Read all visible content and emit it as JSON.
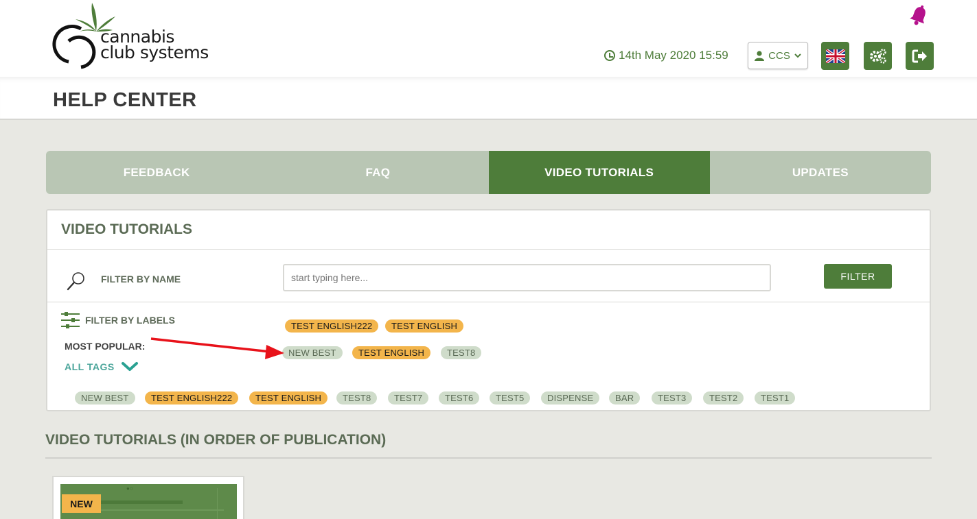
{
  "header": {
    "logo_line1": "cannabis",
    "logo_line2": "club systems",
    "datetime": "14th May 2020 15:59",
    "user_label": "CCS"
  },
  "page_title": "HELP CENTER",
  "tabs": [
    {
      "label": "FEEDBACK",
      "active": false
    },
    {
      "label": "FAQ",
      "active": false
    },
    {
      "label": "VIDEO TUTORIALS",
      "active": true
    },
    {
      "label": "UPDATES",
      "active": false
    }
  ],
  "panel": {
    "title": "VIDEO TUTORIALS",
    "filter_by_name_label": "FILTER BY NAME",
    "search_placeholder": "start typing here...",
    "filter_button": "FILTER",
    "filter_by_labels_label": "FILTER BY LABELS",
    "most_popular_label": "MOST POPULAR:",
    "all_tags_label": "ALL TAGS",
    "selected_tags": [
      "TEST ENGLISH222",
      "TEST ENGLISH"
    ],
    "popular_tags": [
      "NEW BEST",
      "TEST ENGLISH",
      "TEST8"
    ],
    "all_tags": [
      "NEW BEST",
      "TEST ENGLISH222",
      "TEST ENGLISH",
      "TEST8",
      "TEST7",
      "TEST6",
      "TEST5",
      "DISPENSE",
      "BAR",
      "TEST3",
      "TEST2",
      "TEST1"
    ]
  },
  "section_title": "VIDEO TUTORIALS (IN ORDER OF PUBLICATION)",
  "card": {
    "badge": "NEW"
  },
  "colors": {
    "primary_green": "#4e7d3a",
    "tag_orange": "#f3b54b",
    "tag_green": "#cfdcca",
    "tab_inactive": "#b9c6b4",
    "bell": "#b5128c",
    "arrow": "#e8121a"
  }
}
